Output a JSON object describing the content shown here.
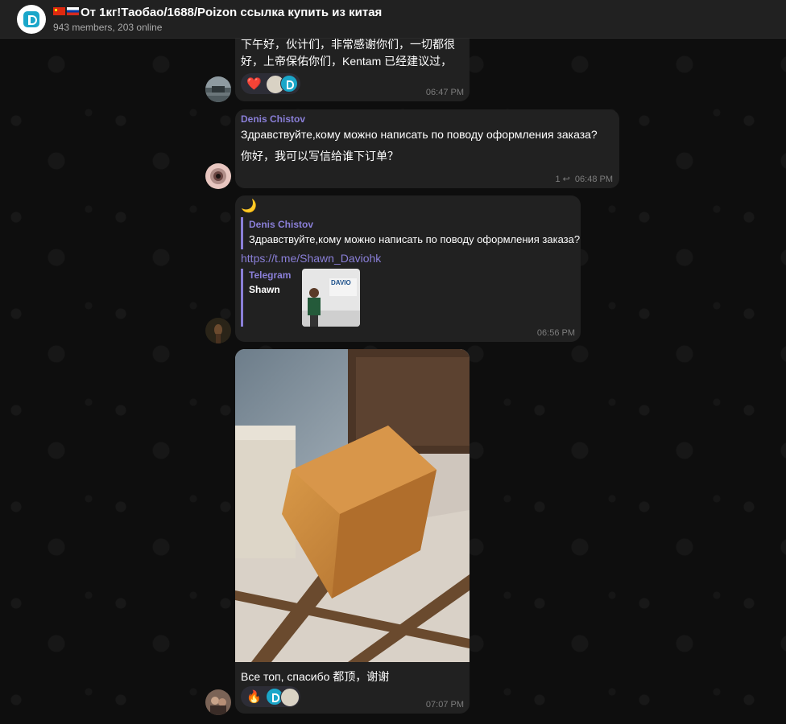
{
  "header": {
    "title": "От 1кг!Таобао/1688/Poizon ссылка купить из китая",
    "subtitle": "943 members, 203 online"
  },
  "messages": [
    {
      "text_line1": "下午好，伙计们，非常感谢你们，一切都很",
      "text_line2": "好，上帝保佑你们，Kentam 已经建议过，",
      "reactions": {
        "emoji": "❤️"
      },
      "time": "06:47 PM"
    },
    {
      "sender": "Denis Chistov",
      "text_ru": "Здравствуйте,кому можно написать по поводу оформления заказа?",
      "text_cn": "你好，我可以写信给谁下订单？",
      "replies": "1",
      "time": "06:48 PM"
    },
    {
      "emoji": "🌙",
      "reply_sender": "Denis Chistov",
      "reply_text": "Здравствуйте,кому можно написать по поводу оформления заказа?",
      "link": "https://t.me/Shawn_Daviohk",
      "preview_site": "Telegram",
      "preview_title": "Shawn",
      "preview_logo_text": "DAVIO",
      "time": "06:56 PM"
    },
    {
      "caption": "Все топ, спасибо 都顶，谢谢",
      "reactions": {
        "emoji": "🔥"
      },
      "time": "07:07 PM"
    }
  ]
}
